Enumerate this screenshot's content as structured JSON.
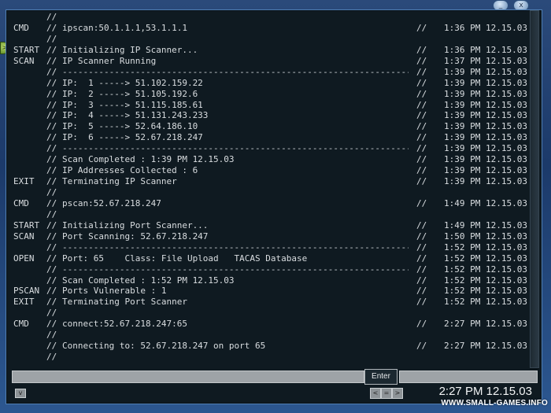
{
  "terminal": {
    "lines": [
      {
        "tag": "",
        "slashes": "//",
        "text": "",
        "dashed": false,
        "time_slashes": "",
        "time": ""
      },
      {
        "tag": "CMD",
        "slashes": "//",
        "text": "ipscan:50.1.1.1,53.1.1.1",
        "dashed": false,
        "time_slashes": "//",
        "time": "1:36 PM 12.15.03"
      },
      {
        "tag": "",
        "slashes": "//",
        "text": "",
        "dashed": false,
        "time_slashes": "",
        "time": ""
      },
      {
        "tag": "START",
        "slashes": "//",
        "text": "Initializing IP Scanner...",
        "dashed": false,
        "time_slashes": "//",
        "time": "1:36 PM 12.15.03"
      },
      {
        "tag": "SCAN",
        "slashes": "//",
        "text": "IP Scanner Running",
        "dashed": false,
        "time_slashes": "//",
        "time": "1:37 PM 12.15.03"
      },
      {
        "tag": "",
        "slashes": "//",
        "text": "------------------------------------------------------------------------------------------",
        "dashed": true,
        "time_slashes": "//",
        "time": "1:39 PM 12.15.03"
      },
      {
        "tag": "",
        "slashes": "//",
        "text": "IP:  1 -----> 51.102.159.22",
        "dashed": false,
        "time_slashes": "//",
        "time": "1:39 PM 12.15.03"
      },
      {
        "tag": "",
        "slashes": "//",
        "text": "IP:  2 -----> 51.105.192.6",
        "dashed": false,
        "time_slashes": "//",
        "time": "1:39 PM 12.15.03"
      },
      {
        "tag": "",
        "slashes": "//",
        "text": "IP:  3 -----> 51.115.185.61",
        "dashed": false,
        "time_slashes": "//",
        "time": "1:39 PM 12.15.03"
      },
      {
        "tag": "",
        "slashes": "//",
        "text": "IP:  4 -----> 51.131.243.233",
        "dashed": false,
        "time_slashes": "//",
        "time": "1:39 PM 12.15.03"
      },
      {
        "tag": "",
        "slashes": "//",
        "text": "IP:  5 -----> 52.64.186.10",
        "dashed": false,
        "time_slashes": "//",
        "time": "1:39 PM 12.15.03"
      },
      {
        "tag": "",
        "slashes": "//",
        "text": "IP:  6 -----> 52.67.218.247",
        "dashed": false,
        "time_slashes": "//",
        "time": "1:39 PM 12.15.03"
      },
      {
        "tag": "",
        "slashes": "//",
        "text": "------------------------------------------------------------------------------------------",
        "dashed": true,
        "time_slashes": "//",
        "time": "1:39 PM 12.15.03"
      },
      {
        "tag": "",
        "slashes": "//",
        "text": "Scan Completed : 1:39 PM 12.15.03",
        "dashed": false,
        "time_slashes": "//",
        "time": "1:39 PM 12.15.03"
      },
      {
        "tag": "",
        "slashes": "//",
        "text": "IP Addresses Collected : 6",
        "dashed": false,
        "time_slashes": "//",
        "time": "1:39 PM 12.15.03"
      },
      {
        "tag": "EXIT",
        "slashes": "//",
        "text": "Terminating IP Scanner",
        "dashed": false,
        "time_slashes": "//",
        "time": "1:39 PM 12.15.03"
      },
      {
        "tag": "",
        "slashes": "//",
        "text": "",
        "dashed": false,
        "time_slashes": "",
        "time": ""
      },
      {
        "tag": "CMD",
        "slashes": "//",
        "text": "pscan:52.67.218.247",
        "dashed": false,
        "time_slashes": "//",
        "time": "1:49 PM 12.15.03"
      },
      {
        "tag": "",
        "slashes": "//",
        "text": "",
        "dashed": false,
        "time_slashes": "",
        "time": ""
      },
      {
        "tag": "START",
        "slashes": "//",
        "text": "Initializing Port Scanner...",
        "dashed": false,
        "time_slashes": "//",
        "time": "1:49 PM 12.15.03"
      },
      {
        "tag": "SCAN",
        "slashes": "//",
        "text": "Port Scanning: 52.67.218.247",
        "dashed": false,
        "time_slashes": "//",
        "time": "1:50 PM 12.15.03"
      },
      {
        "tag": "",
        "slashes": "//",
        "text": "------------------------------------------------------------------------------------------",
        "dashed": true,
        "time_slashes": "//",
        "time": "1:52 PM 12.15.03"
      },
      {
        "tag": "OPEN",
        "slashes": "//",
        "text": "Port: 65    Class: File Upload   TACAS Database",
        "dashed": false,
        "time_slashes": "//",
        "time": "1:52 PM 12.15.03"
      },
      {
        "tag": "",
        "slashes": "//",
        "text": "------------------------------------------------------------------------------------------",
        "dashed": true,
        "time_slashes": "//",
        "time": "1:52 PM 12.15.03"
      },
      {
        "tag": "",
        "slashes": "//",
        "text": "Scan Completed : 1:52 PM 12.15.03",
        "dashed": false,
        "time_slashes": "//",
        "time": "1:52 PM 12.15.03"
      },
      {
        "tag": "PSCAN",
        "slashes": "//",
        "text": "Ports Vulnerable : 1",
        "dashed": false,
        "time_slashes": "//",
        "time": "1:52 PM 12.15.03"
      },
      {
        "tag": "EXIT",
        "slashes": "//",
        "text": "Terminating Port Scanner",
        "dashed": false,
        "time_slashes": "//",
        "time": "1:52 PM 12.15.03"
      },
      {
        "tag": "",
        "slashes": "//",
        "text": "",
        "dashed": false,
        "time_slashes": "",
        "time": ""
      },
      {
        "tag": "CMD",
        "slashes": "//",
        "text": "connect:52.67.218.247:65",
        "dashed": false,
        "time_slashes": "//",
        "time": "2:27 PM 12.15.03"
      },
      {
        "tag": "",
        "slashes": "//",
        "text": "",
        "dashed": false,
        "time_slashes": "",
        "time": ""
      },
      {
        "tag": "",
        "slashes": "//",
        "text": "Connecting to: 52.67.218.247 on port 65",
        "dashed": false,
        "time_slashes": "//",
        "time": "2:27 PM 12.15.03"
      },
      {
        "tag": "",
        "slashes": "//",
        "text": "",
        "dashed": false,
        "time_slashes": "",
        "time": ""
      }
    ]
  },
  "input": {
    "value": "",
    "enter_label": "Enter"
  },
  "statusbar": {
    "clock": "2:27 PM 12.15.03",
    "corner_glyph": "v",
    "nav_prev_glyph": "<",
    "nav_mid_glyph": "=",
    "nav_next_glyph": ">"
  },
  "window": {
    "minimize_glyph": "_",
    "close_glyph": "x",
    "left_tab_glyph": ">"
  },
  "watermark": "WWW.SMALL-GAMES.INFO",
  "colors": {
    "background": "#0f1a21",
    "text": "#d9dde0",
    "frame": "#4f7fb4",
    "desktop": "#1c3a6a"
  }
}
